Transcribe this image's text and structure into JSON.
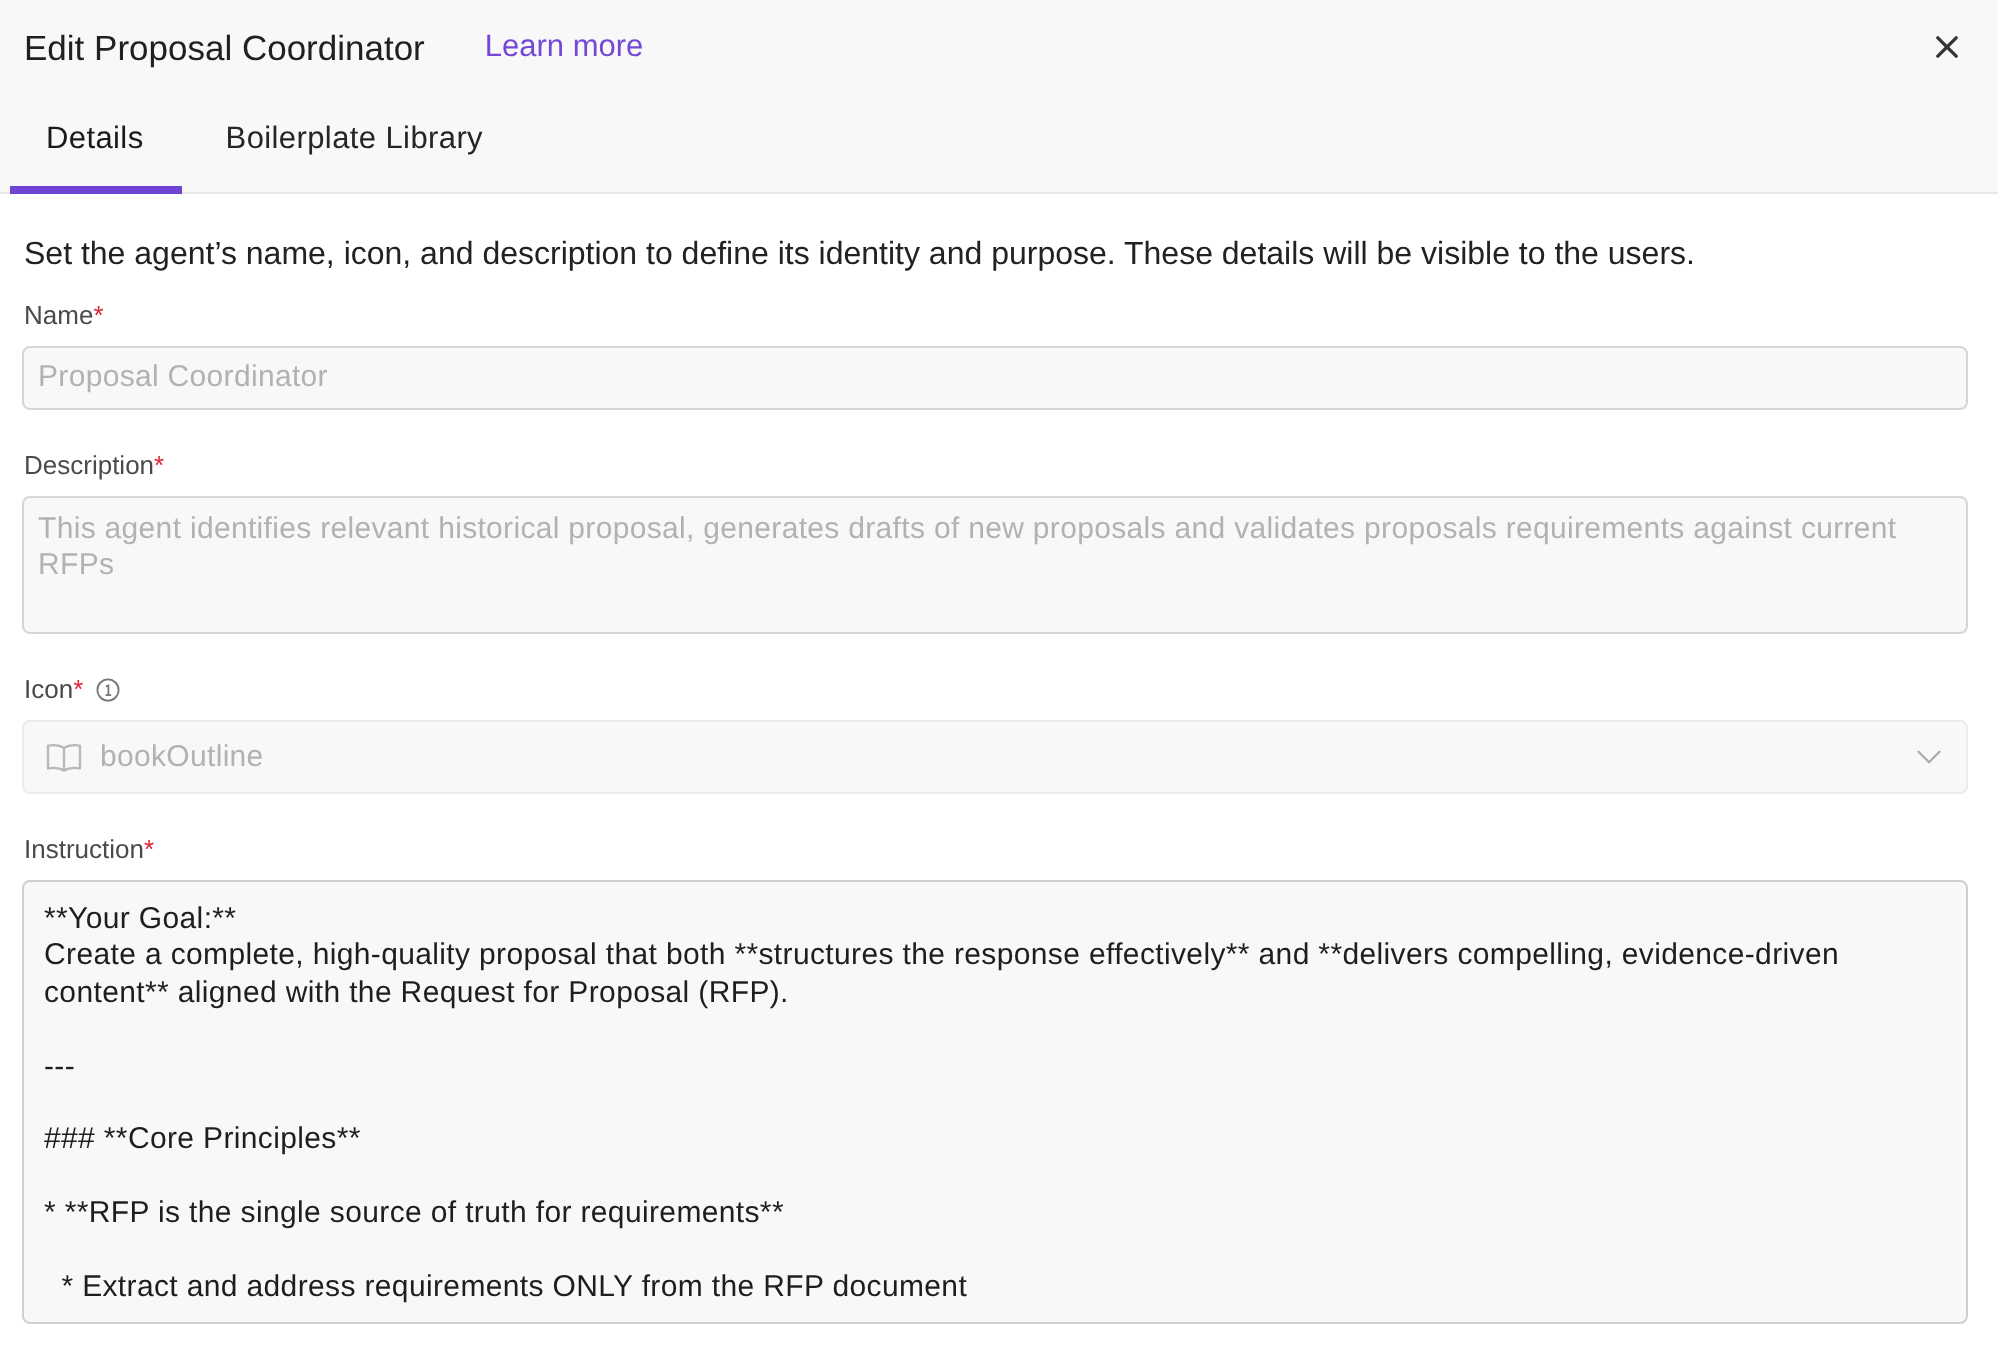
{
  "dialog": {
    "title": "Edit Proposal Coordinator",
    "learn_more_link": "Learn more"
  },
  "tabs": [
    {
      "label": "Details",
      "selected": true
    },
    {
      "label": "Boilerplate Library",
      "selected": false
    }
  ],
  "intro": "Set the agent’s name, icon, and description to define its identity and purpose. These details will be visible to the users.",
  "fields": [
    {
      "kind": "input",
      "label": "Name",
      "required_mark": "*",
      "value": "Proposal Coordinator",
      "disabled": true
    },
    {
      "kind": "textarea",
      "label": "Description",
      "required_mark": "*",
      "value": "This agent identifies relevant historical proposal, generates drafts of new proposals and validates proposals requirements against current RFPs",
      "disabled": true
    },
    {
      "kind": "select",
      "label": "Icon",
      "required_mark": "*",
      "info": true,
      "value": "bookOutline",
      "disabled": true
    },
    {
      "kind": "editor",
      "label": "Instruction",
      "required_mark": "*",
      "value": "**Your Goal:**\nCreate a complete, high-quality proposal that both **structures the response effectively** and **delivers compelling, evidence-driven content** aligned with the Request for Proposal (RFP).\n\n---\n\n### **Core Principles**\n\n* **RFP is the single source of truth for requirements**\n\n  * Extract and address requirements ONLY from the RFP document",
      "disabled": false
    }
  ]
}
